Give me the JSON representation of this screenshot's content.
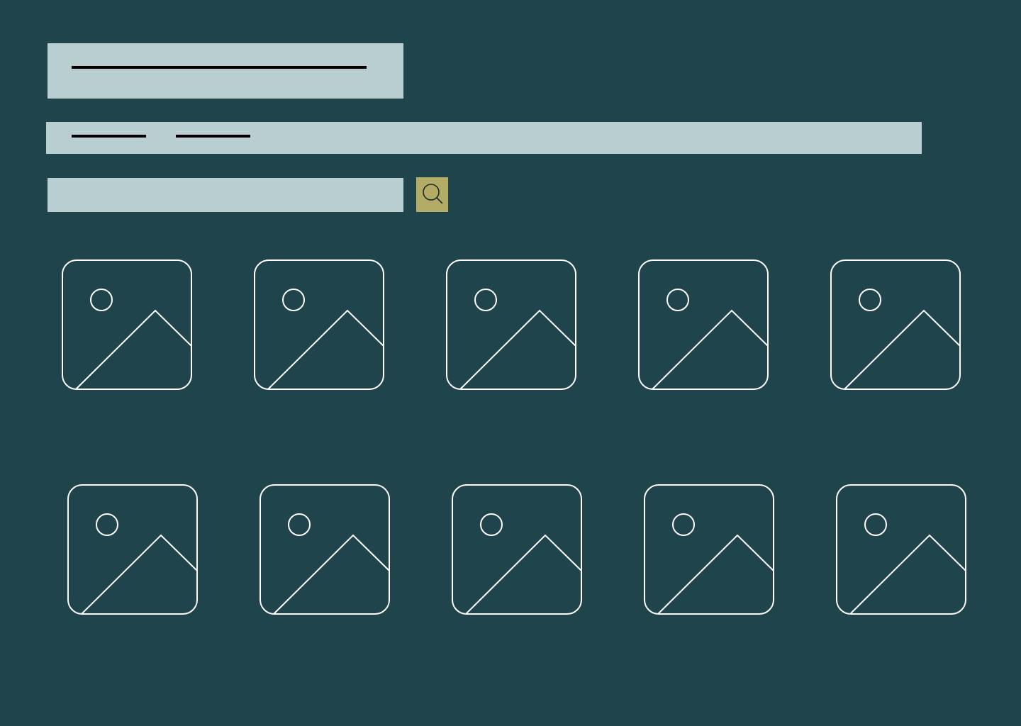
{
  "colors": {
    "background": "#1f444b",
    "panel": "#b9ced1",
    "accent": "#b3ac66",
    "line": "#000000",
    "outline": "#ffffff"
  },
  "header": {
    "title": "",
    "title_icon": "text-placeholder-line"
  },
  "nav": {
    "items": [
      {
        "label": "",
        "icon": "text-placeholder-line"
      },
      {
        "label": "",
        "icon": "text-placeholder-line"
      }
    ]
  },
  "search": {
    "value": "",
    "placeholder": "",
    "button_icon": "search-icon"
  },
  "gallery": {
    "rows": [
      [
        {
          "icon": "image-placeholder-icon"
        },
        {
          "icon": "image-placeholder-icon"
        },
        {
          "icon": "image-placeholder-icon"
        },
        {
          "icon": "image-placeholder-icon"
        },
        {
          "icon": "image-placeholder-icon"
        }
      ],
      [
        {
          "icon": "image-placeholder-icon"
        },
        {
          "icon": "image-placeholder-icon"
        },
        {
          "icon": "image-placeholder-icon"
        },
        {
          "icon": "image-placeholder-icon"
        },
        {
          "icon": "image-placeholder-icon"
        }
      ]
    ]
  }
}
